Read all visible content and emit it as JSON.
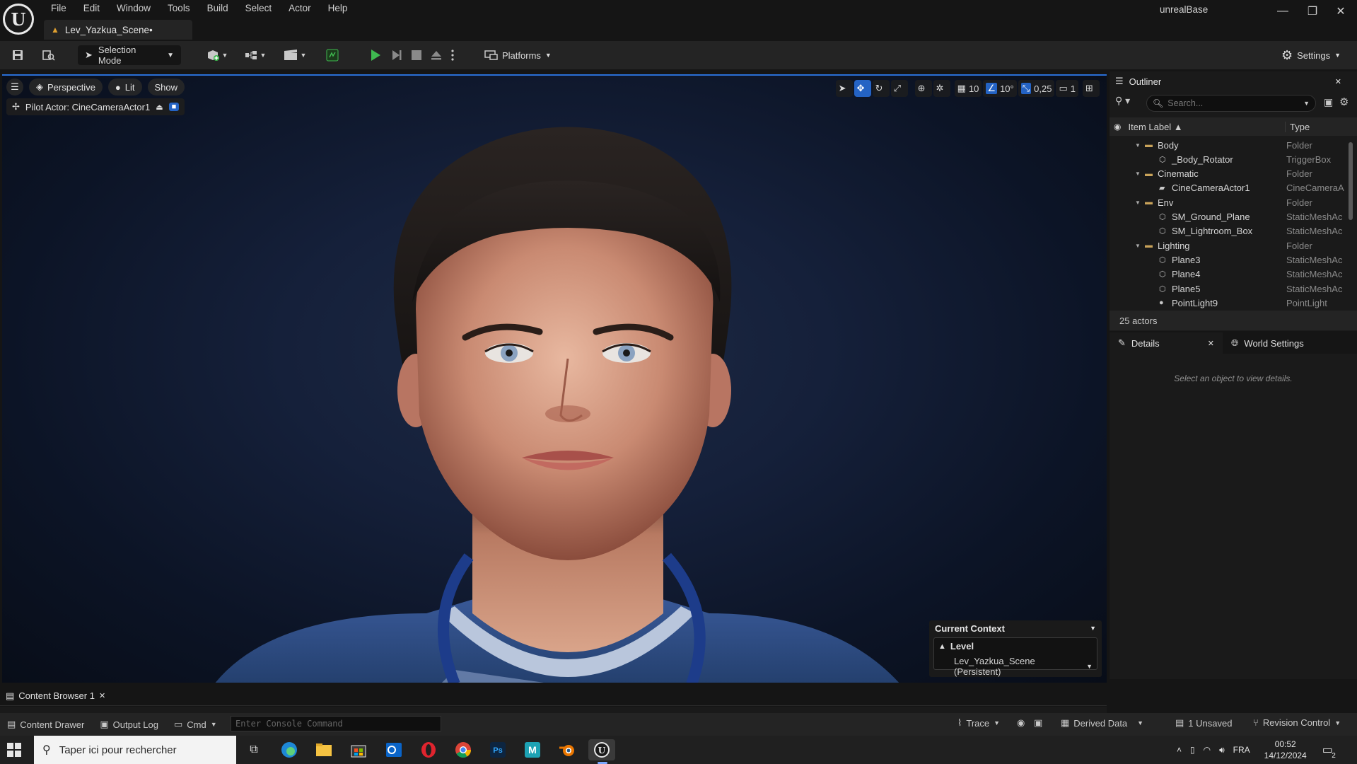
{
  "app": {
    "project_name": "unrealBase",
    "level_tab": "Lev_Yazkua_Scene•",
    "menu": [
      "File",
      "Edit",
      "Window",
      "Tools",
      "Build",
      "Select",
      "Actor",
      "Help"
    ]
  },
  "toolbar": {
    "selection_mode": "Selection Mode",
    "platforms": "Platforms",
    "settings": "Settings"
  },
  "viewport": {
    "hamburger_icon": "menu-icon",
    "perspective": "Perspective",
    "lit": "Lit",
    "show": "Show",
    "pilot_actor": "Pilot Actor: CineCameraActor1",
    "grid_snap": "10",
    "rotation_snap": "10°",
    "scale_snap": "0,25",
    "camera_speed": "1"
  },
  "context": {
    "title": "Current Context",
    "level_label": "Level",
    "level_value": "Lev_Yazkua_Scene (Persistent)"
  },
  "outliner": {
    "tab": "Outliner",
    "search_placeholder": "Search...",
    "col_label": "Item Label ▲",
    "col_type": "Type",
    "items": [
      {
        "label": "Body",
        "type": "Folder",
        "depth": 0,
        "kind": "folder"
      },
      {
        "label": "_Body_Rotator",
        "type": "TriggerBox",
        "depth": 1,
        "kind": "actor"
      },
      {
        "label": "Cinematic",
        "type": "Folder",
        "depth": 0,
        "kind": "folder"
      },
      {
        "label": "CineCameraActor1",
        "type": "CineCameraA",
        "depth": 1,
        "kind": "camera"
      },
      {
        "label": "Env",
        "type": "Folder",
        "depth": 0,
        "kind": "folder"
      },
      {
        "label": "SM_Ground_Plane",
        "type": "StaticMeshAc",
        "depth": 1,
        "kind": "mesh"
      },
      {
        "label": "SM_Lightroom_Box",
        "type": "StaticMeshAc",
        "depth": 1,
        "kind": "mesh"
      },
      {
        "label": "Lighting",
        "type": "Folder",
        "depth": 0,
        "kind": "folder"
      },
      {
        "label": "Plane3",
        "type": "StaticMeshAc",
        "depth": 1,
        "kind": "mesh"
      },
      {
        "label": "Plane4",
        "type": "StaticMeshAc",
        "depth": 1,
        "kind": "mesh"
      },
      {
        "label": "Plane5",
        "type": "StaticMeshAc",
        "depth": 1,
        "kind": "mesh"
      },
      {
        "label": "PointLight9",
        "type": "PointLight",
        "depth": 1,
        "kind": "light"
      }
    ],
    "footer": "25 actors"
  },
  "details": {
    "tab": "Details",
    "world_settings_tab": "World Settings",
    "empty_text": "Select an object to view details."
  },
  "bottom": {
    "content_browser_tab": "Content Browser 1",
    "content_drawer": "Content Drawer",
    "output_log": "Output Log",
    "cmd": "Cmd",
    "console_placeholder": "Enter Console Command",
    "trace": "Trace",
    "derived_data": "Derived Data",
    "unsaved": "1 Unsaved",
    "revision_control": "Revision Control"
  },
  "taskbar": {
    "search_placeholder": "Taper ici pour rechercher",
    "language": "FRA",
    "time": "00:52",
    "date": "14/12/2024",
    "notification_count": "2"
  },
  "colors": {
    "accent": "#2463c4",
    "panel": "#1a1a1a",
    "toolbar": "#242424",
    "play_green": "#3fb950"
  }
}
